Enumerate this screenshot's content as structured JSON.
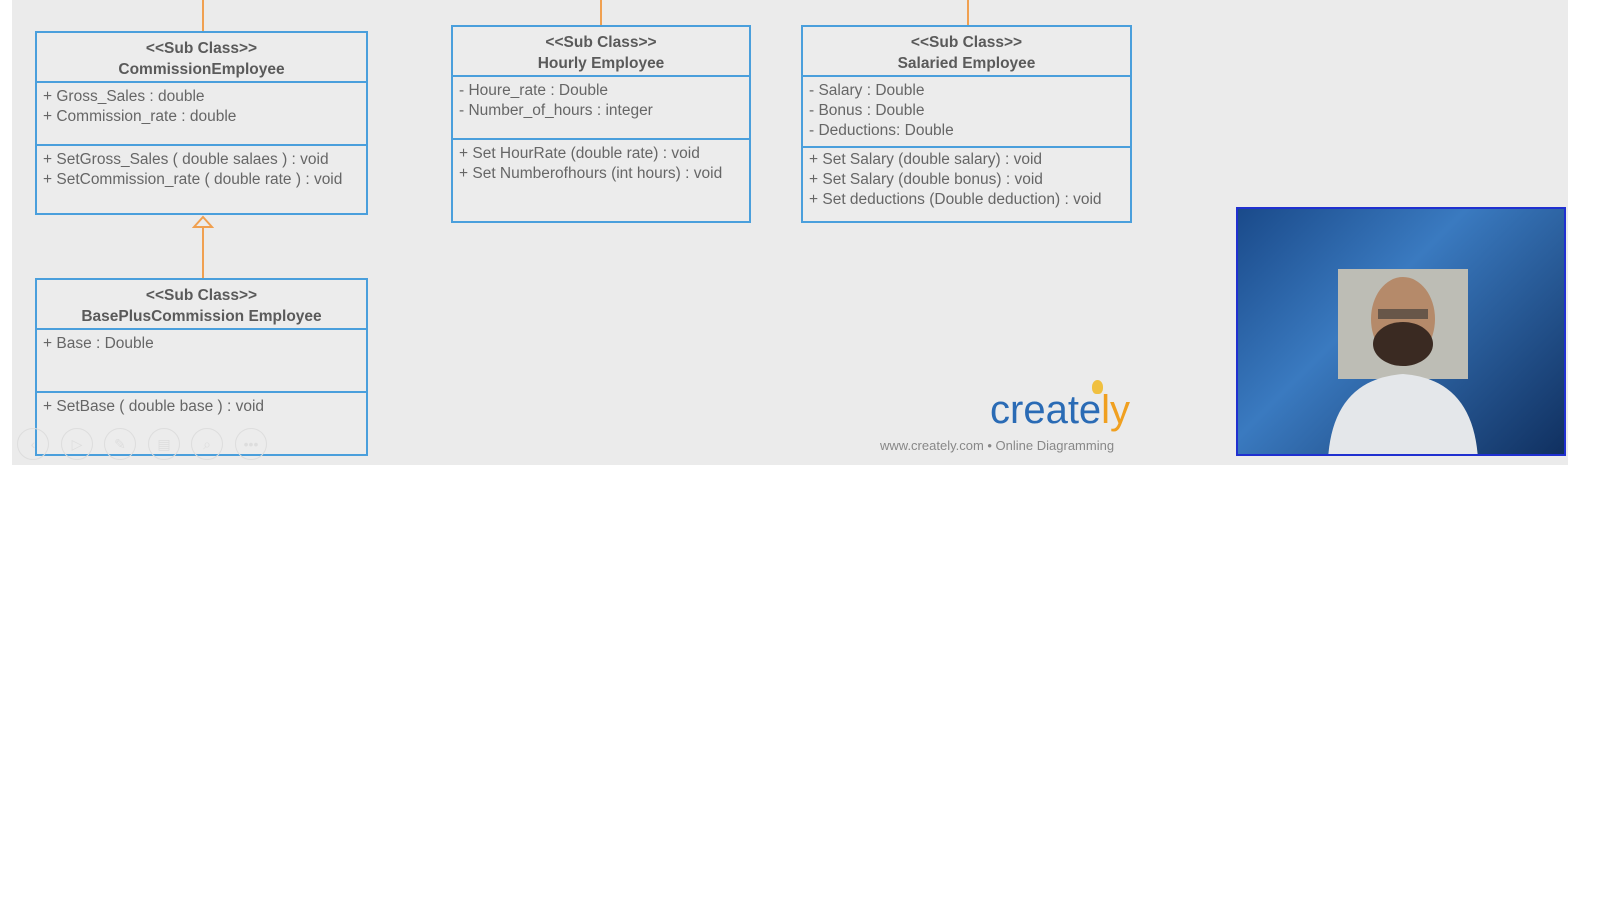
{
  "classes": [
    {
      "stereotype": "<<Sub Class>>",
      "name": "CommissionEmployee",
      "attributes": [
        "+ Gross_Sales : double",
        "+ Commission_rate : double"
      ],
      "methods": [
        "+ SetGross_Sales ( double salaes ) : void",
        "+ SetCommission_rate ( double rate ) : void"
      ]
    },
    {
      "stereotype": "<<Sub Class>>",
      "name": "BasePlusCommission Employee",
      "attributes": [
        "+ Base : Double"
      ],
      "methods": [
        "+ SetBase  ( double base ) : void"
      ]
    },
    {
      "stereotype": "<<Sub Class>>",
      "name": "Hourly Employee",
      "attributes": [
        "- Houre_rate : Double",
        "- Number_of_hours : integer"
      ],
      "methods": [
        "+ Set HourRate (double rate) : void",
        "+ Set Numberofhours (int hours) : void"
      ]
    },
    {
      "stereotype": "<<Sub Class>>",
      "name": "Salaried Employee",
      "attributes": [
        "- Salary : Double",
        "- Bonus : Double",
        "- Deductions: Double"
      ],
      "methods": [
        "+ Set Salary (double salary) : void",
        "+ Set Salary (double bonus) : void",
        "+ Set deductions (Double deduction) : void"
      ]
    }
  ],
  "logo": {
    "main": "create",
    "accent": "ly",
    "tagline": "www.creately.com • Online Diagramming"
  },
  "controls": [
    "prev-icon",
    "play-icon",
    "pen-icon",
    "slides-icon",
    "zoom-icon",
    "more-icon"
  ],
  "colors": {
    "border": "#4a9fdc",
    "connector": "#f0a050"
  }
}
